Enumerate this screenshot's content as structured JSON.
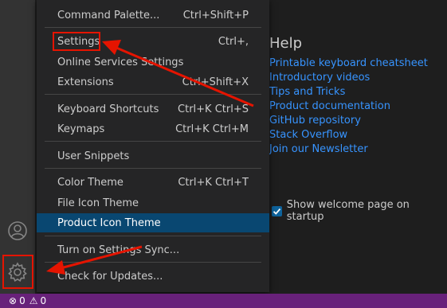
{
  "menu": {
    "items": [
      {
        "label": "Command Palette...",
        "shortcut": "Ctrl+Shift+P"
      },
      {
        "label": "Settings",
        "shortcut": "Ctrl+,"
      },
      {
        "label": "Online Services Settings",
        "shortcut": ""
      },
      {
        "label": "Extensions",
        "shortcut": "Ctrl+Shift+X"
      },
      {
        "label": "Keyboard Shortcuts",
        "shortcut": "Ctrl+K Ctrl+S"
      },
      {
        "label": "Keymaps",
        "shortcut": "Ctrl+K Ctrl+M"
      },
      {
        "label": "User Snippets",
        "shortcut": ""
      },
      {
        "label": "Color Theme",
        "shortcut": "Ctrl+K Ctrl+T"
      },
      {
        "label": "File Icon Theme",
        "shortcut": ""
      },
      {
        "label": "Product Icon Theme",
        "shortcut": ""
      },
      {
        "label": "Turn on Settings Sync...",
        "shortcut": ""
      },
      {
        "label": "Check for Updates...",
        "shortcut": ""
      }
    ],
    "selected_index": 9
  },
  "help": {
    "title": "Help",
    "links": [
      "Printable keyboard cheatsheet",
      "Introductory videos",
      "Tips and Tricks",
      "Product documentation",
      "GitHub repository",
      "Stack Overflow",
      "Join our Newsletter"
    ]
  },
  "startup": {
    "label": "Show welcome page on startup",
    "checked": true
  },
  "status_bar": {
    "errors": "0",
    "warnings": "0"
  },
  "activity_bar": {
    "icons": [
      "account-icon",
      "gear-icon"
    ]
  },
  "colors": {
    "accent": "#68217a",
    "link": "#3794ff",
    "selection": "#094771",
    "annotation": "#e51400"
  }
}
